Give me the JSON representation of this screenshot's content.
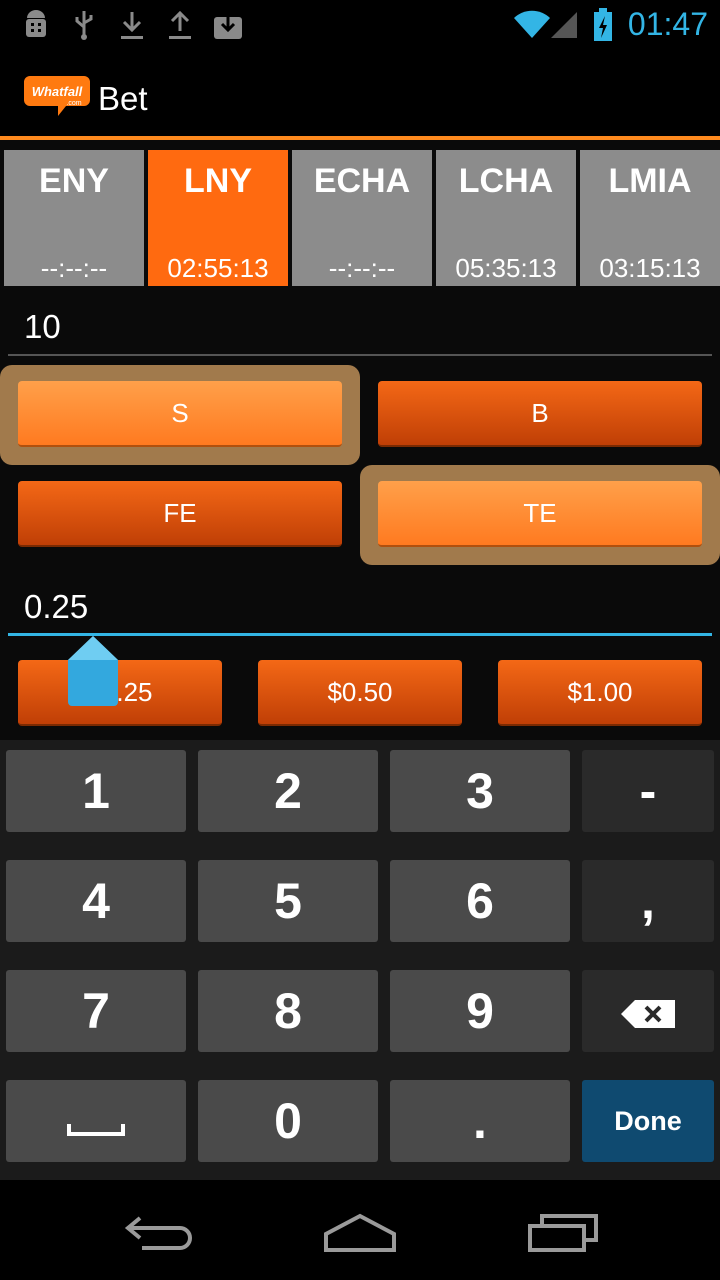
{
  "status_bar": {
    "icons": [
      "android-debug-icon",
      "usb-icon",
      "download-icon",
      "upload-icon",
      "download-box-icon",
      "wifi-icon",
      "signal-icon",
      "battery-charging-icon"
    ],
    "time": "01:47",
    "accent_color": "#33b5e5"
  },
  "action_bar": {
    "logo_text": "Whatfall",
    "logo_subtext": ".com",
    "title": "Bet",
    "accent_color": "#ff8a1e"
  },
  "tabs": [
    {
      "name": "ENY",
      "time": "--:--:--",
      "active": false
    },
    {
      "name": "LNY",
      "time": "02:55:13",
      "active": true
    },
    {
      "name": "ECHA",
      "time": "--:--:--",
      "active": false
    },
    {
      "name": "LCHA",
      "time": "05:35:13",
      "active": false
    },
    {
      "name": "LMIA",
      "time": "03:15:13",
      "active": false
    }
  ],
  "amount": {
    "value": "10"
  },
  "options": [
    {
      "label": "S",
      "selected": true
    },
    {
      "label": "B",
      "selected": false
    },
    {
      "label": "FE",
      "selected": false
    },
    {
      "label": "TE",
      "selected": true
    }
  ],
  "price": {
    "value": "0.25"
  },
  "price_buttons": [
    "$0.25",
    "$0.50",
    "$1.00"
  ],
  "keyboard": {
    "rows": [
      [
        "1",
        "2",
        "3",
        "-"
      ],
      [
        "4",
        "5",
        "6",
        ","
      ],
      [
        "7",
        "8",
        "9",
        "backspace-icon"
      ],
      [
        "space-icon",
        "0",
        ".",
        "Done"
      ]
    ],
    "done_label": "Done"
  },
  "nav_bar": {
    "icons": [
      "back-icon",
      "home-icon",
      "recent-apps-icon"
    ]
  }
}
